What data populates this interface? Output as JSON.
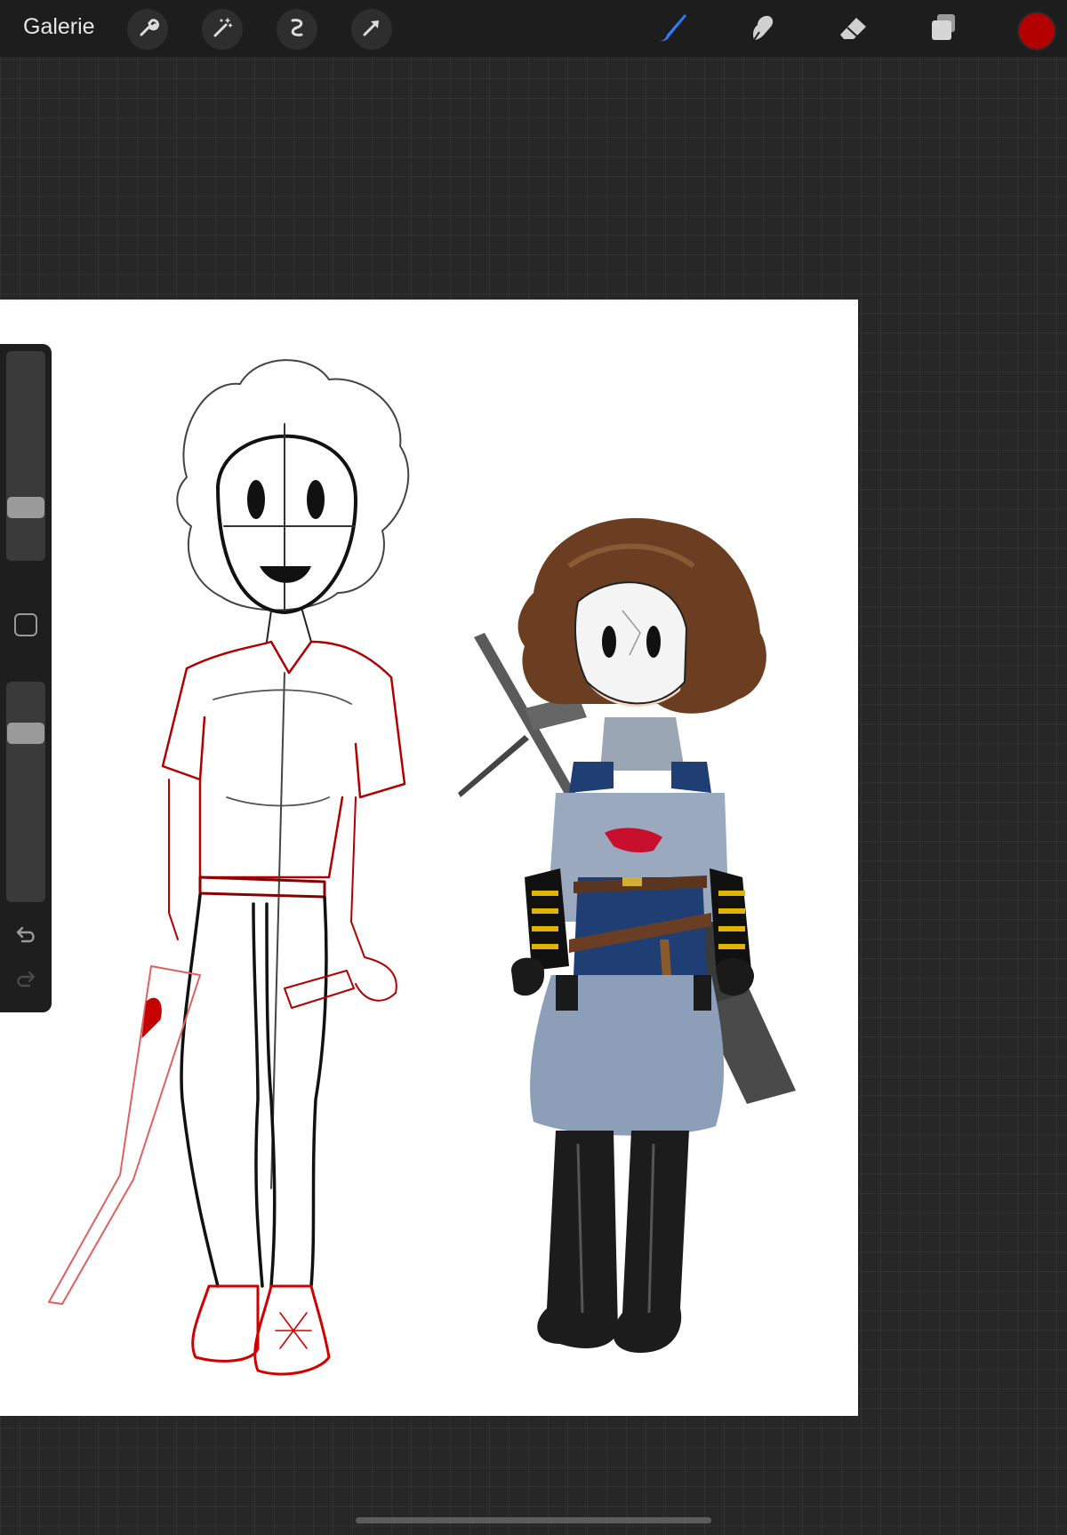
{
  "topbar": {
    "gallery_label": "Galerie",
    "left_tools": [
      "wrench-icon",
      "magic-wand-icon",
      "selection-icon",
      "transform-arrow-icon"
    ],
    "right_tools": [
      "brush-icon",
      "smudge-icon",
      "eraser-icon",
      "layers-icon"
    ],
    "active_tool": "brush-icon",
    "current_color": "#b30000"
  },
  "sidebar": {
    "brush_size_level": 0.22,
    "opacity_level": 0.8,
    "icons": [
      "modify-button-icon",
      "undo-icon",
      "redo-icon"
    ]
  },
  "canvas": {
    "background": "#ffffff",
    "content": "sketch-and-colored-character-artwork"
  },
  "colors": {
    "accent_brush": "#2f7bf0",
    "sketch_red": "#c40000"
  }
}
